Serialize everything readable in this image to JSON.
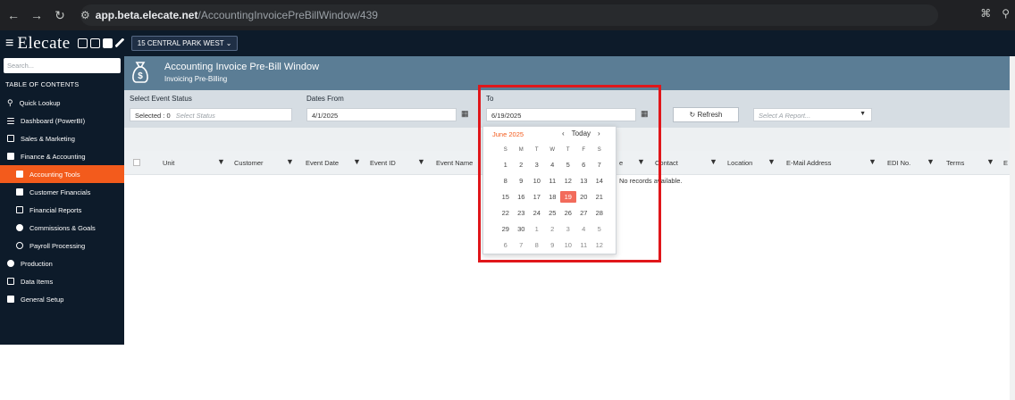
{
  "browser": {
    "url_host": "app.beta.elecate.net",
    "url_path": "/AccountingInvoicePreBillWindow/439"
  },
  "header": {
    "logo": "Elecate",
    "location": "15 CENTRAL PARK WEST"
  },
  "sidebar": {
    "search_placeholder": "Search...",
    "toc_title": "TABLE OF CONTENTS",
    "items": [
      {
        "label": "Quick Lookup",
        "icon": "search-icon"
      },
      {
        "label": "Dashboard (PowerBI)",
        "icon": "menu-icon"
      },
      {
        "label": "Sales & Marketing",
        "icon": "chart-icon"
      },
      {
        "label": "Finance & Accounting",
        "icon": "bank-icon"
      },
      {
        "label": "Accounting Tools",
        "icon": "document-icon",
        "active": true
      },
      {
        "label": "Customer Financials",
        "icon": "ledger-icon"
      },
      {
        "label": "Financial Reports",
        "icon": "printer-icon"
      },
      {
        "label": "Commissions & Goals",
        "icon": "money-icon"
      },
      {
        "label": "Payroll Processing",
        "icon": "payroll-icon"
      },
      {
        "label": "Production",
        "icon": "production-icon"
      },
      {
        "label": "Data Items",
        "icon": "list-icon"
      },
      {
        "label": "General Setup",
        "icon": "setup-icon"
      }
    ]
  },
  "page": {
    "title": "Accounting Invoice Pre-Bill Window",
    "subtitle": "Invoicing Pre-Billing"
  },
  "filters": {
    "event_status_label": "Select Event Status",
    "event_status_selected": "Selected : 0",
    "event_status_placeholder": "Select Status",
    "dates_from_label": "Dates From",
    "dates_from_value": "4/1/2025",
    "to_label": "To",
    "to_value": "6/19/2025",
    "refresh_label": "Refresh",
    "report_placeholder": "Select A Report..."
  },
  "grid": {
    "columns": [
      "Unit",
      "Customer",
      "Event Date",
      "Event ID",
      "Event Name",
      "e",
      "Contact",
      "Location",
      "E-Mail Address",
      "EDI No.",
      "Terms",
      "E"
    ],
    "empty_message": "No records available."
  },
  "datepicker": {
    "month_label": "June 2025",
    "today_label": "Today",
    "prev": "‹",
    "next": "›",
    "days_of_week": [
      "S",
      "M",
      "T",
      "W",
      "T",
      "F",
      "S"
    ],
    "weeks": [
      [
        "1",
        "2",
        "3",
        "4",
        "5",
        "6",
        "7"
      ],
      [
        "8",
        "9",
        "10",
        "11",
        "12",
        "13",
        "14"
      ],
      [
        "15",
        "16",
        "17",
        "18",
        "19",
        "20",
        "21"
      ],
      [
        "22",
        "23",
        "24",
        "25",
        "26",
        "27",
        "28"
      ],
      [
        "29",
        "30",
        "1",
        "2",
        "3",
        "4",
        "5"
      ],
      [
        "6",
        "7",
        "8",
        "9",
        "10",
        "11",
        "12"
      ]
    ],
    "selected_day": "19",
    "accent_color": "#f26b5b"
  },
  "colors": {
    "sidebar_bg": "#0d1b2a",
    "active_item": "#f35b1c",
    "title_bar": "#5b7d95",
    "highlight": "#e0161a"
  }
}
